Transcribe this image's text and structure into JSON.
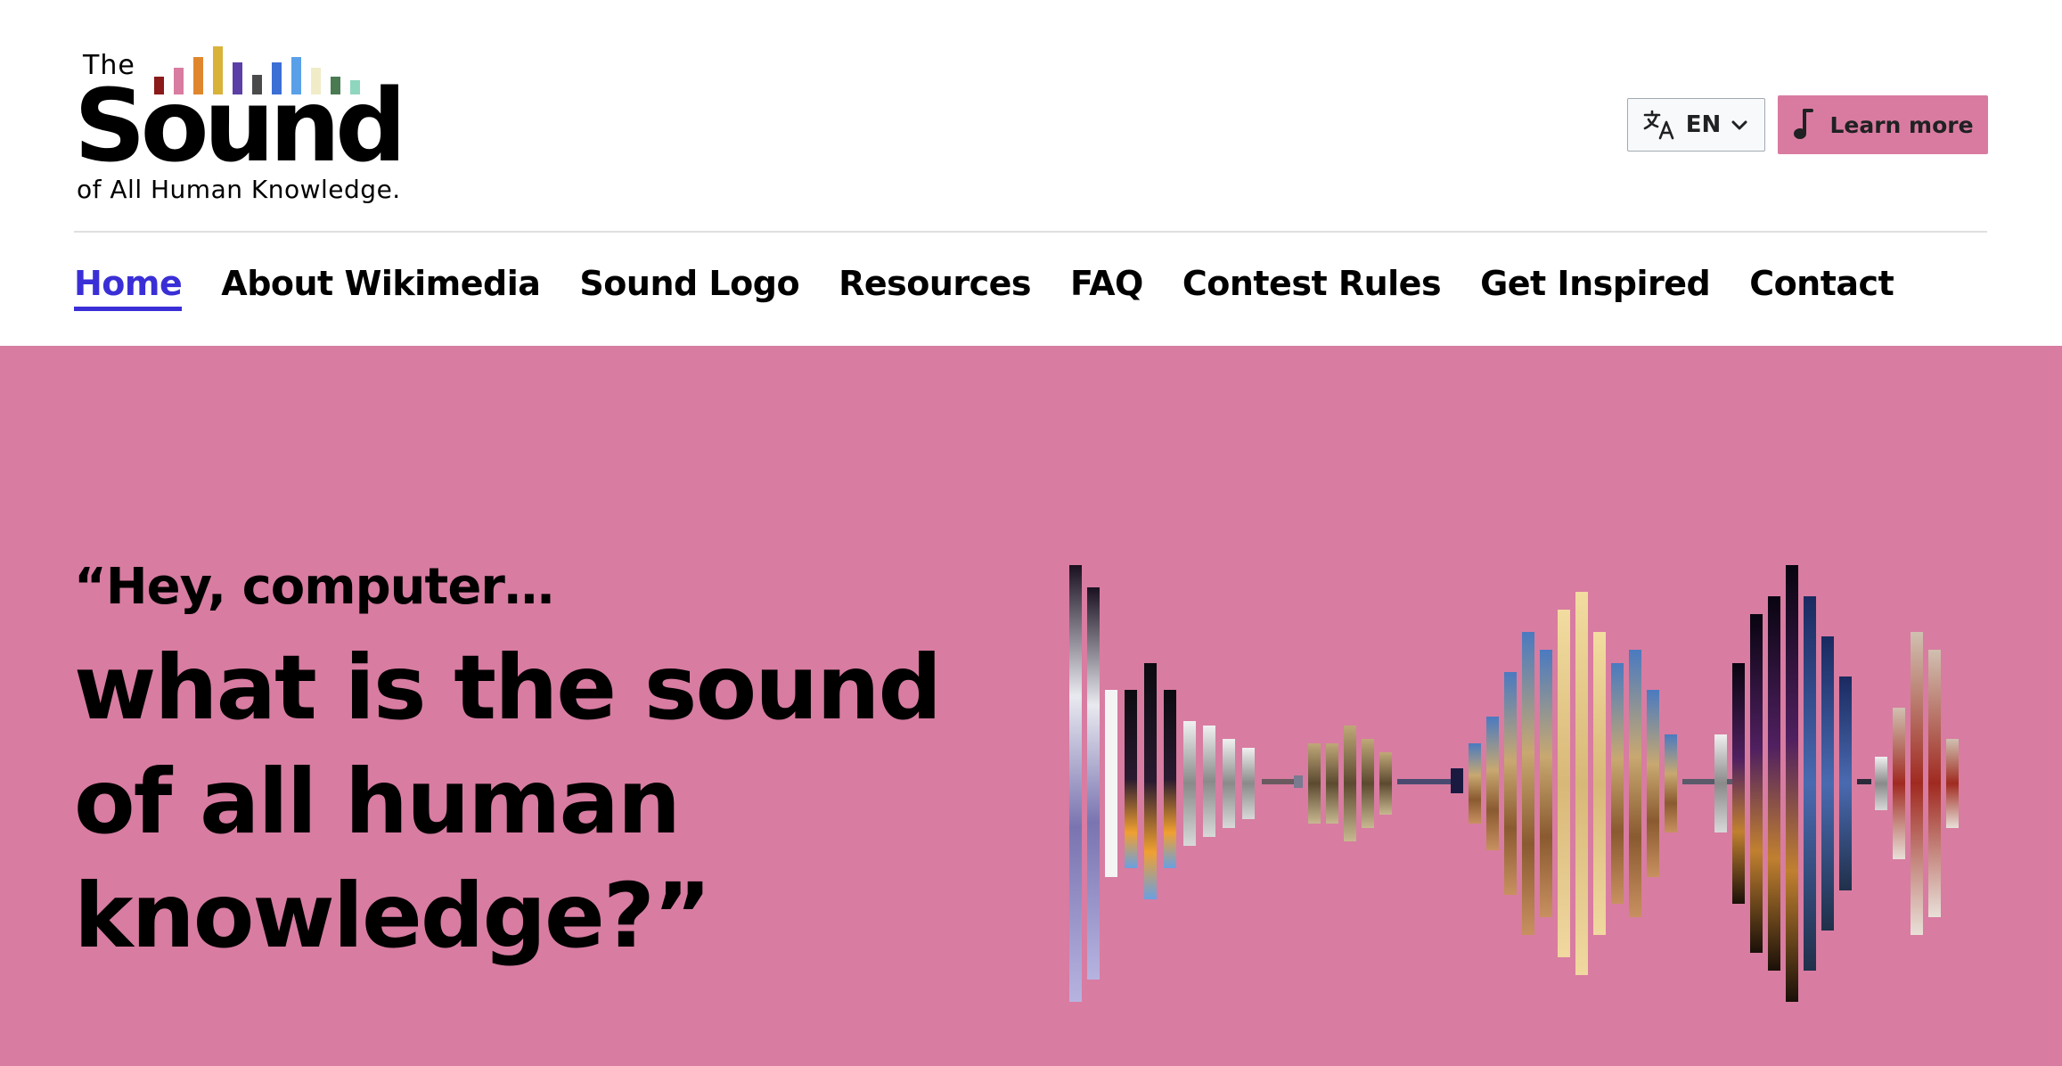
{
  "logo": {
    "the": "The",
    "word": "Sound",
    "tagline": "of All Human Knowledge.",
    "bar_colors": [
      "#8b1a1a",
      "#d87ca1",
      "#e0872e",
      "#d9b23a",
      "#5b3fa6",
      "#4a4a4a",
      "#3b6fd6",
      "#5aa0e8",
      "#f1ecc8",
      "#4a7a52",
      "#8fd6bf"
    ]
  },
  "header": {
    "language": {
      "code": "EN",
      "icon": "translate-icon",
      "chevron": "chevron-down-icon"
    },
    "learn_more": {
      "label": "Learn more",
      "icon": "music-note-icon",
      "bg": "#d97ba0"
    }
  },
  "nav": {
    "active_color": "#3a2fd6",
    "items": [
      {
        "label": "Home",
        "active": true
      },
      {
        "label": "About Wikimedia"
      },
      {
        "label": "Sound Logo"
      },
      {
        "label": "Resources"
      },
      {
        "label": "FAQ"
      },
      {
        "label": "Contest Rules"
      },
      {
        "label": "Get Inspired"
      },
      {
        "label": "Contact"
      }
    ]
  },
  "hero": {
    "bg": "#d87ca1",
    "lead": "“Hey, computer…",
    "headline": "what is the sound of all human knowledge?”",
    "waveform_description_icon": "image-waveform"
  }
}
